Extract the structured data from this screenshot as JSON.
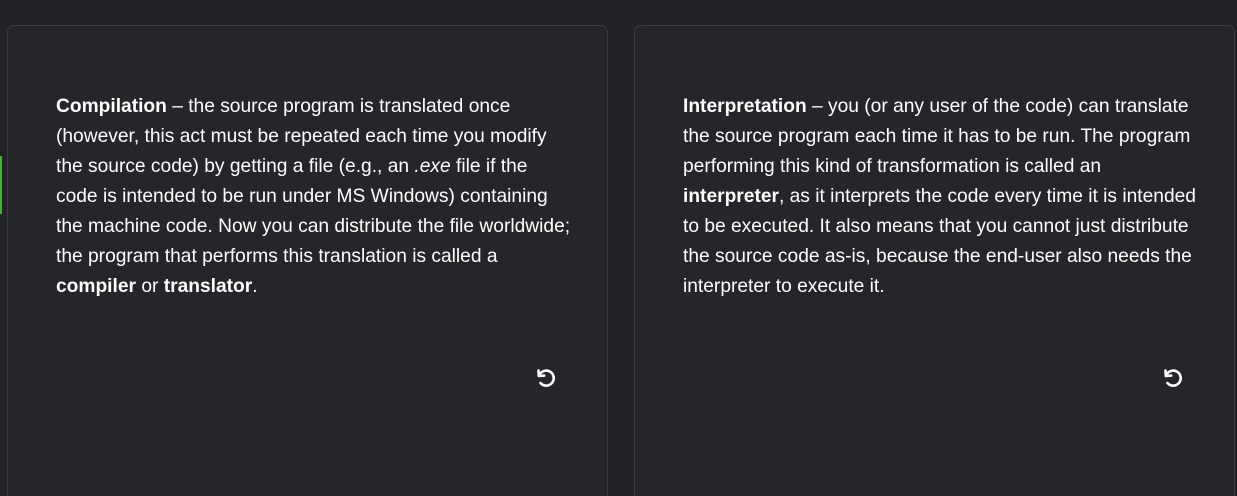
{
  "cards": [
    {
      "term": "Compilation",
      "dash": " – ",
      "text1": "the source program is translated once (however, this act must be repeated each time you modify the source code) by getting a file (e.g., an ",
      "ext": ".exe",
      "text2": " file if the code is intended to be run under MS Windows) containing the machine code. Now you can distribute the file worldwide; the program that performs this translation is called a ",
      "bold1": "compiler",
      "text3": " or ",
      "bold2": "translator",
      "text4": ".",
      "flip_icon": "rotate-ccw-icon"
    },
    {
      "term": "Interpretation",
      "dash": " – ",
      "text1": "you (or any user of the code) can translate the source program each time it has to be run. The program performing this kind of transformation is called an ",
      "bold1": "interpreter",
      "text2": ", as it interprets the code every time it is intended to be executed. It also means that you cannot just distribute the source code as-is, because the end-user also needs the interpreter to execute it.",
      "flip_icon": "rotate-ccw-icon"
    }
  ],
  "colors": {
    "background": "#222326",
    "card": "#252629",
    "card_border": "#3a3b40",
    "text": "#ffffff",
    "accent": "#4caf3a"
  }
}
